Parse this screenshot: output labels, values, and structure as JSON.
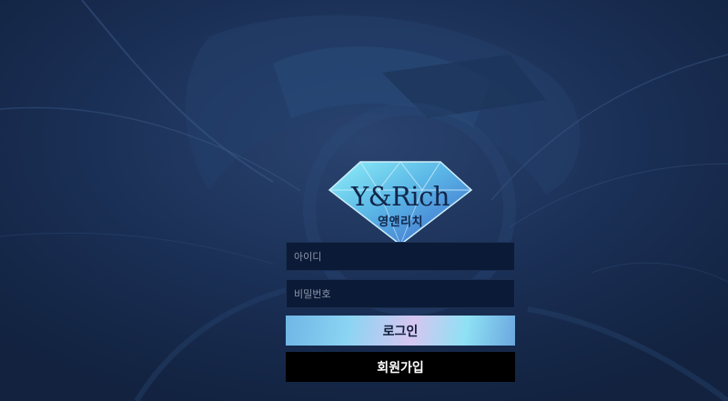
{
  "brand": {
    "title": "Y&Rich",
    "subtitle": "영앤리치",
    "colors": {
      "gem_light": "#7fe3f5",
      "gem_mid": "#4fa9e0",
      "gem_dark": "#3b6fcd",
      "text": "#12264a"
    }
  },
  "login_form": {
    "id_placeholder": "아이디",
    "pw_placeholder": "비밀번호",
    "login_label": "로그인",
    "signup_label": "회원가입"
  },
  "theme": {
    "background": "#16284a",
    "field_bg": "#0b1a36",
    "signup_bg": "#000000"
  }
}
